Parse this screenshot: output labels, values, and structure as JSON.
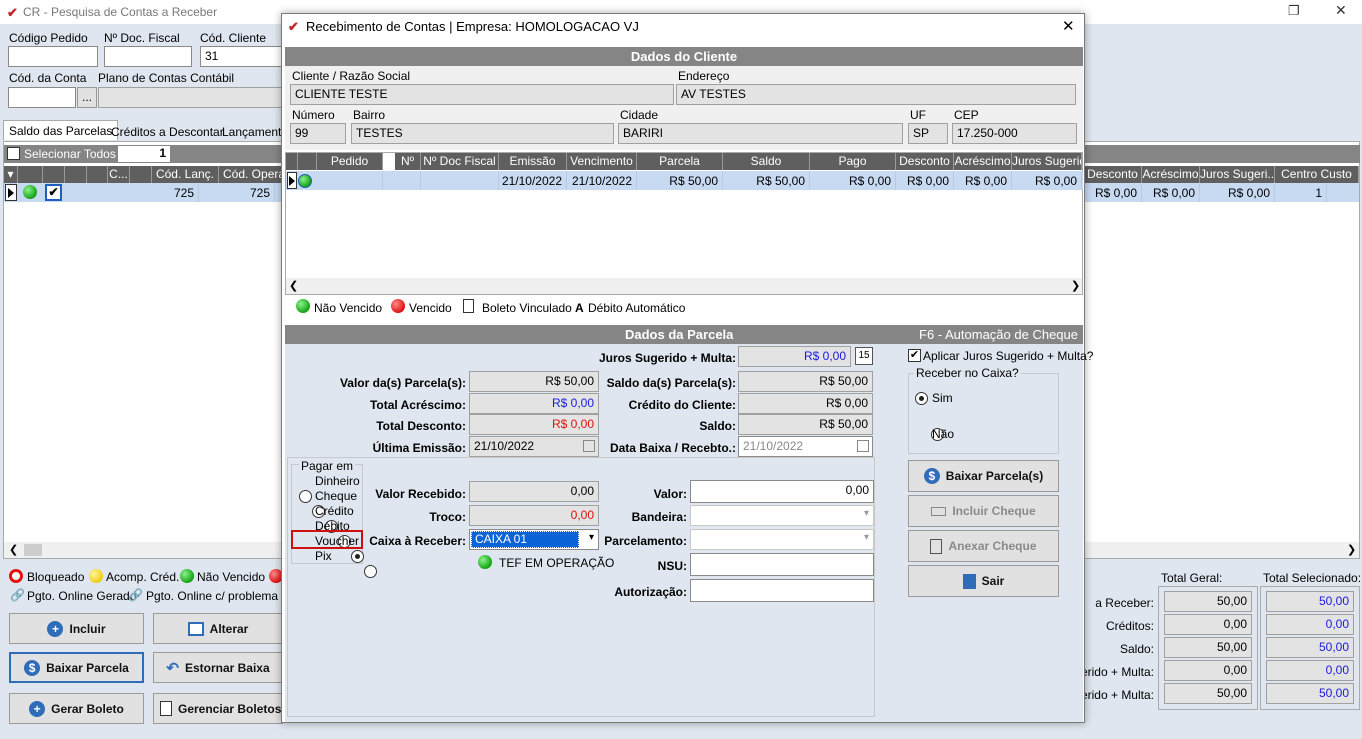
{
  "bg": {
    "title": "CR - Pesquisa de Contas a Receber",
    "fields": {
      "codigo_pedido": "Código Pedido",
      "nr_doc_fiscal": "Nº Doc. Fiscal",
      "cod_cliente": "Cód. Cliente",
      "cod_cliente_value": "31",
      "cod_conta": "Cód. da Conta",
      "plano_contas": "Plano de Contas Contábil",
      "ellipsis": "..."
    },
    "tabs": [
      "Saldo das Parcelas",
      "Créditos a Descontar",
      "Lançamento"
    ],
    "selecionar_todos": "Selecionar Todos",
    "selected_count": "1",
    "grid_headers_left": [
      "C...",
      "Cód. Lanç.",
      "Cód. Opera"
    ],
    "row_left": {
      "cod_lanc": "725",
      "cod_oper": "725"
    },
    "grid_headers_right": [
      "Desconto",
      "Acréscimo",
      "Juros Sugeri...",
      "Centro Custo"
    ],
    "row_right": {
      "desconto": "R$ 0,00",
      "acrescimo": "R$ 0,00",
      "juros": "R$ 0,00",
      "centro": "1"
    },
    "legend": [
      "Bloqueado",
      "Acomp. Créd.",
      "Não Vencido",
      "Pgto. Online Gerado",
      "Pgto. Online c/ problema"
    ],
    "buttons": {
      "incluir": "Incluir",
      "alterar": "Alterar",
      "baixar": "Baixar Parcela",
      "estornar": "Estornar Baixa",
      "gerar_boleto": "Gerar Boleto",
      "gerenciar": "Gerenciar Boletos"
    },
    "totals": {
      "total_geral": "Total Geral:",
      "total_selecionado": "Total Selecionado:",
      "rows": [
        {
          "label": "a Receber:",
          "geral": "50,00",
          "sel": "50,00"
        },
        {
          "label": "Créditos:",
          "geral": "0,00",
          "sel": "0,00"
        },
        {
          "label": "Saldo:",
          "geral": "50,00",
          "sel": "50,00"
        },
        {
          "label": "gerido + Multa:",
          "geral": "0,00",
          "sel": "0,00"
        },
        {
          "label": "gerido + Multa:",
          "geral": "50,00",
          "sel": "50,00"
        }
      ]
    }
  },
  "dlg": {
    "title": "Recebimento de Contas | Empresa: HOMOLOGACAO VJ",
    "close": "✕",
    "dados_cliente": "Dados do Cliente",
    "cliente_label": "Cliente / Razão Social",
    "cliente": "CLIENTE TESTE",
    "endereco_label": "Endereço",
    "endereco": "AV TESTES",
    "numero_label": "Número",
    "numero": "99",
    "bairro_label": "Bairro",
    "bairro": "TESTES",
    "cidade_label": "Cidade",
    "cidade": "BARIRI",
    "uf_label": "UF",
    "uf": "SP",
    "cep_label": "CEP",
    "cep": "17.250-000",
    "grid_headers": [
      "Pedido",
      "Nº",
      "Nº Doc Fiscal",
      "Emissão",
      "Vencimento",
      "Parcela",
      "Saldo",
      "Pago",
      "Desconto",
      "Acréscimo",
      "Juros Sugerid"
    ],
    "row": {
      "emissao": "21/10/2022",
      "vencimento": "21/10/2022",
      "parcela": "R$ 50,00",
      "saldo": "R$ 50,00",
      "pago": "R$ 0,00",
      "desconto": "R$ 0,00",
      "acrescimo": "R$ 0,00",
      "juros": "R$ 0,00"
    },
    "legend": {
      "nao_vencido": "Não Vencido",
      "vencido": "Vencido",
      "boleto": "Boleto Vinculado",
      "debito": "Débito Automático",
      "debito_icon": "A"
    },
    "dados_parcela": "Dados da Parcela",
    "f6": "F6 - Automação de Cheque",
    "juros_label": "Juros Sugerido + Multa:",
    "juros": "R$ 0,00",
    "aplicar_juros": "Aplicar Juros Sugerido + Multa?",
    "valor_parcelas_label": "Valor da(s) Parcela(s):",
    "valor_parcelas": "R$ 50,00",
    "saldo_parcelas_label": "Saldo da(s) Parcela(s):",
    "saldo_parcelas": "R$ 50,00",
    "total_acrescimo_label": "Total Acréscimo:",
    "total_acrescimo": "R$ 0,00",
    "credito_cliente_label": "Crédito do Cliente:",
    "credito_cliente": "R$ 0,00",
    "total_desconto_label": "Total Desconto:",
    "total_desconto": "R$ 0,00",
    "saldo_label": "Saldo:",
    "saldo": "R$ 50,00",
    "ultima_emissao_label": "Última Emissão:",
    "ultima_emissao": "21/10/2022",
    "data_baixa_label": "Data Baixa / Recebto.:",
    "data_baixa": "21/10/2022",
    "receber_caixa": "Receber no Caixa?",
    "sim": "Sim",
    "nao": "Não",
    "pagar_em": "Pagar em",
    "pay_options": [
      "Dinheiro",
      "Cheque",
      "Crédito",
      "Débito",
      "Voucher",
      "Pix"
    ],
    "valor_recebido_label": "Valor Recebido:",
    "valor_recebido": "0,00",
    "troco_label": "Troco:",
    "troco": "0,00",
    "caixa_label": "Caixa à Receber:",
    "caixa": "CAIXA 01",
    "tef": "TEF EM OPERAÇÃO",
    "valor_label": "Valor:",
    "valor": "0,00",
    "bandeira_label": "Bandeira:",
    "parcelamento_label": "Parcelamento:",
    "nsu_label": "NSU:",
    "autorizacao_label": "Autorização:",
    "btn_baixar": "Baixar Parcela(s)",
    "btn_incluir_cheque": "Incluir Cheque",
    "btn_anexar_cheque": "Anexar Cheque",
    "btn_sair": "Sair"
  }
}
